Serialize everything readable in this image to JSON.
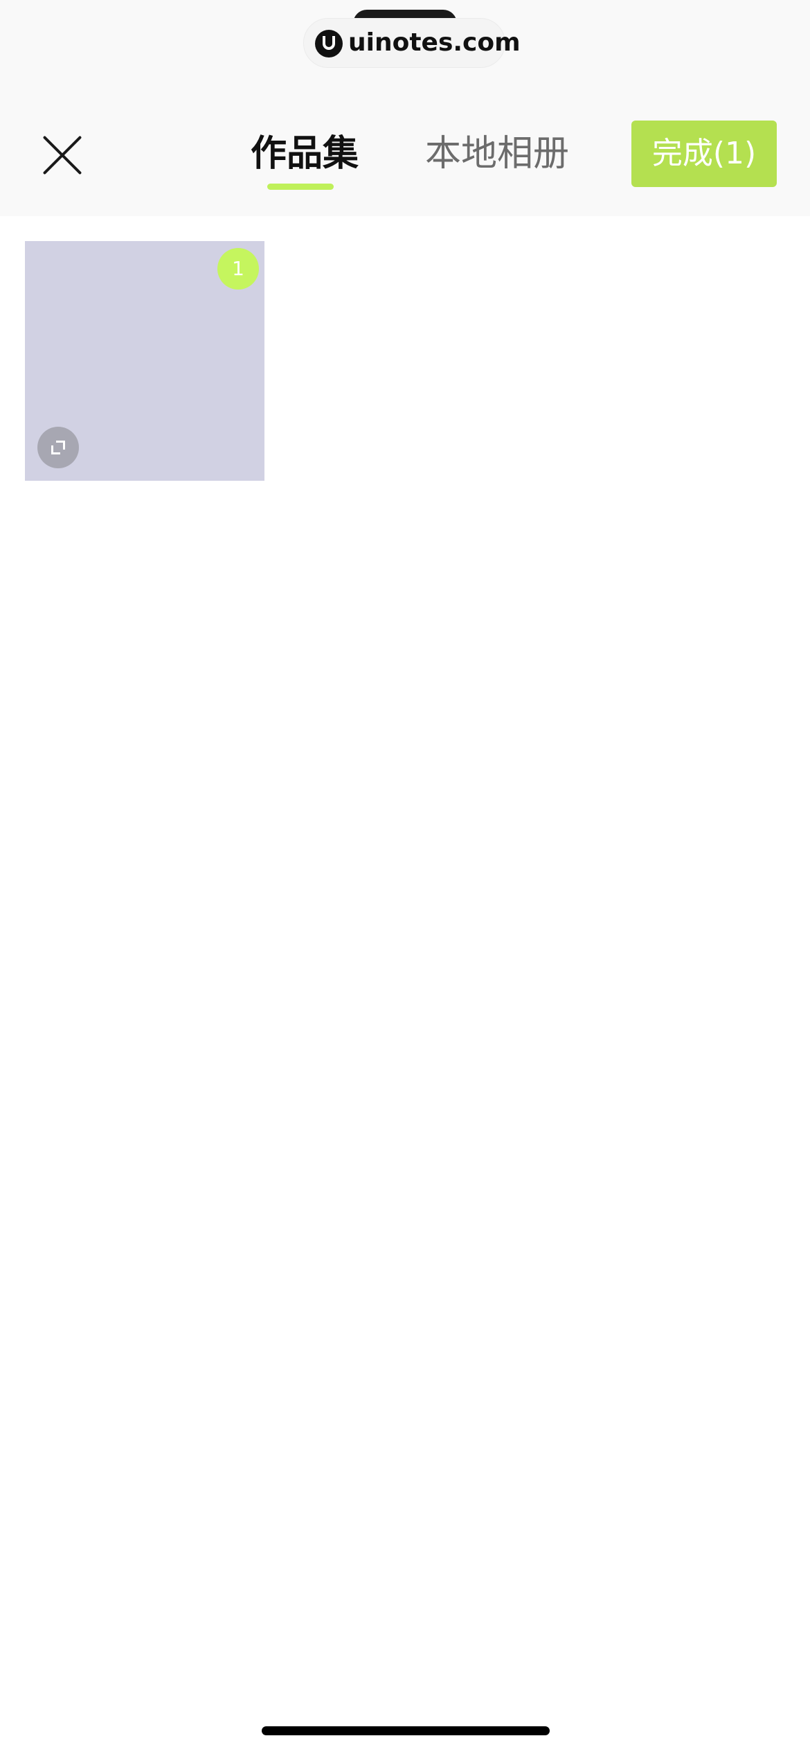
{
  "watermark": {
    "text": "uinotes.com"
  },
  "header": {
    "close_icon": "close-icon",
    "tabs": [
      {
        "label": "作品集",
        "active": true
      },
      {
        "label": "本地相册",
        "active": false
      }
    ],
    "done_label": "完成(1)"
  },
  "grid": {
    "items": [
      {
        "selected_index": "1",
        "expand_icon": "expand-icon"
      }
    ]
  },
  "colors": {
    "accent": "#bff05a",
    "done_button": "#b4e050",
    "thumbnail": "#d1d1e3"
  }
}
